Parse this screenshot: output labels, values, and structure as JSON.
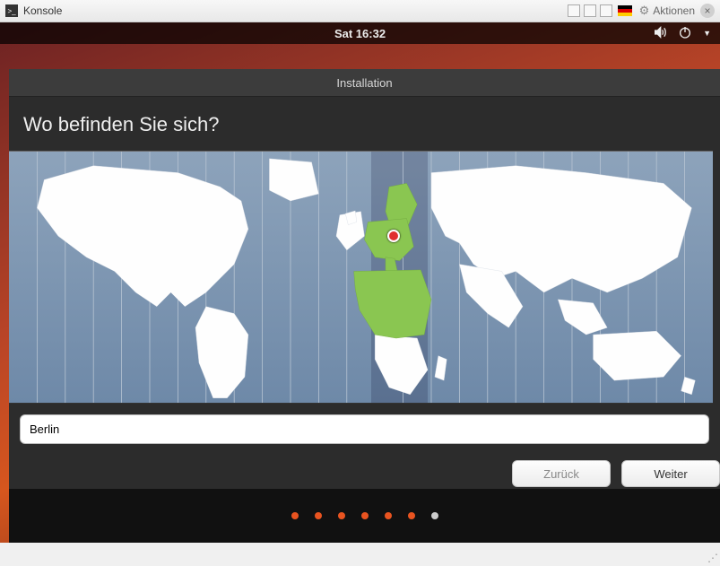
{
  "window": {
    "title": "Konsole",
    "menu_label": "Aktionen"
  },
  "topbar": {
    "datetime": "Sat 16:32"
  },
  "installer": {
    "title": "Installation",
    "question": "Wo befinden Sie sich?",
    "timezone_value": "Berlin",
    "back_label": "Zurück",
    "next_label": "Weiter",
    "progress_total": 7,
    "progress_current": 6
  }
}
